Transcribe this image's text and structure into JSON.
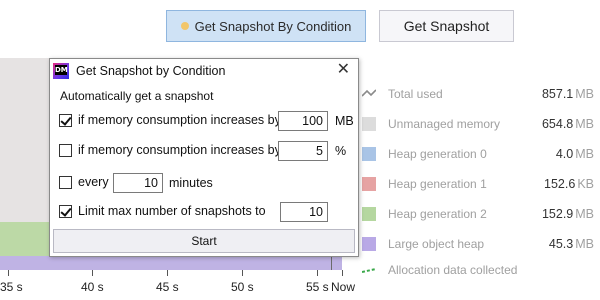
{
  "toolbar": {
    "cond_label": "Get Snapshot By Condition",
    "snap_label": "Get Snapshot"
  },
  "timeline": {
    "labels": [
      "35 s",
      "40 s",
      "45 s",
      "50 s",
      "55 s",
      "Now"
    ]
  },
  "legend": [
    {
      "label": "Total used",
      "value": "857.1",
      "unit": "MB",
      "color": "#8a8a8a"
    },
    {
      "label": "Unmanaged memory",
      "value": "654.8",
      "unit": "MB",
      "color": "#dcdcdc"
    },
    {
      "label": "Heap generation 0",
      "value": "4.0",
      "unit": "MB",
      "color": "#a9c4e6"
    },
    {
      "label": "Heap generation 1",
      "value": "152.6",
      "unit": "KB",
      "color": "#e6a3a3"
    },
    {
      "label": "Heap generation 2",
      "value": "152.9",
      "unit": "MB",
      "color": "#b5d7a0"
    },
    {
      "label": "Large object heap",
      "value": "45.3",
      "unit": "MB",
      "color": "#b9a9e6"
    },
    {
      "label": "Allocation data collected",
      "value": "",
      "unit": "",
      "color": "#3aa84a"
    }
  ],
  "dialog": {
    "title": "Get Snapshot by Condition",
    "section": "Automatically get a snapshot",
    "icon_text": "DM",
    "rows": [
      {
        "label": "if memory consumption increases by",
        "value": "100",
        "unit": "MB",
        "checked": true
      },
      {
        "label": "if memory consumption increases by",
        "value": "5",
        "unit": "%",
        "checked": false
      },
      {
        "label": "every",
        "value": "10",
        "unit": "minutes",
        "checked": false
      },
      {
        "label": "Limit max number of snapshots to",
        "value": "10",
        "unit": "",
        "checked": true
      }
    ],
    "start_label": "Start"
  }
}
